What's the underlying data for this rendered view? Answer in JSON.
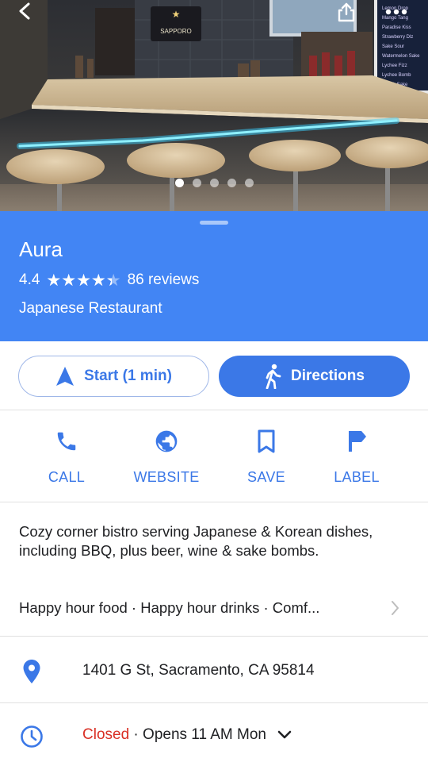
{
  "hero": {
    "photo_count": 5,
    "active_photo_index": 0,
    "sign_text": "SAPPORO",
    "board_lines": [
      "Lemon Drop",
      "Mango Tang",
      "Paradise Kiss",
      "Strawberry Dlz",
      "Sake Sour",
      "Watermelon Sake",
      "Lychee Fizz",
      "Lychee Bomb",
      "Peach Sake"
    ]
  },
  "place": {
    "name": "Aura",
    "rating": "4.4",
    "rating_value": 4.4,
    "reviews": "86 reviews",
    "category": "Japanese Restaurant"
  },
  "buttons": {
    "start_label": "Start (1 min)",
    "directions_label": "Directions"
  },
  "quick_actions": [
    {
      "label": "CALL",
      "icon": "phone-icon"
    },
    {
      "label": "WEBSITE",
      "icon": "globe-icon"
    },
    {
      "label": "SAVE",
      "icon": "bookmark-icon"
    },
    {
      "label": "LABEL",
      "icon": "flag-icon"
    }
  ],
  "details": {
    "description": "Cozy corner bistro serving Japanese & Korean dishes, including BBQ, plus beer, wine & sake bombs.",
    "highlights": "Happy hour food · Happy hour drinks · Comf...",
    "address": "1401 G St, Sacramento, CA 95814",
    "hours_status": "Closed",
    "hours_detail": " · Opens 11 AM Mon"
  },
  "colors": {
    "brand_blue": "#4285f4",
    "accent_blue": "#3b78e7",
    "closed_red": "#d93025"
  }
}
